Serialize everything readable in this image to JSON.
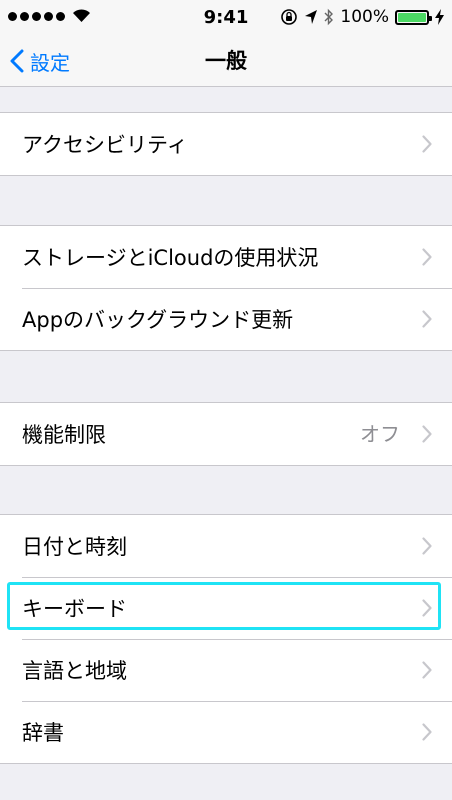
{
  "status_bar": {
    "time": "9:41",
    "battery": "100%",
    "battery_level": 1.0,
    "signal_dots": 5
  },
  "nav": {
    "back_label": "設定",
    "title": "一般"
  },
  "groups": [
    {
      "cells": [
        {
          "label": "アクセシビリティ"
        }
      ]
    },
    {
      "cells": [
        {
          "label": "ストレージとiCloudの使用状況"
        },
        {
          "label": "Appのバックグラウンド更新"
        }
      ]
    },
    {
      "cells": [
        {
          "label": "機能制限",
          "detail": "オフ"
        }
      ]
    },
    {
      "cells": [
        {
          "label": "日付と時刻"
        },
        {
          "label": "キーボード",
          "highlighted": true
        },
        {
          "label": "言語と地域"
        },
        {
          "label": "辞書"
        }
      ]
    }
  ],
  "colors": {
    "accent": "#007aff",
    "highlight": "#1fe3f5",
    "battery": "#4cd964"
  }
}
